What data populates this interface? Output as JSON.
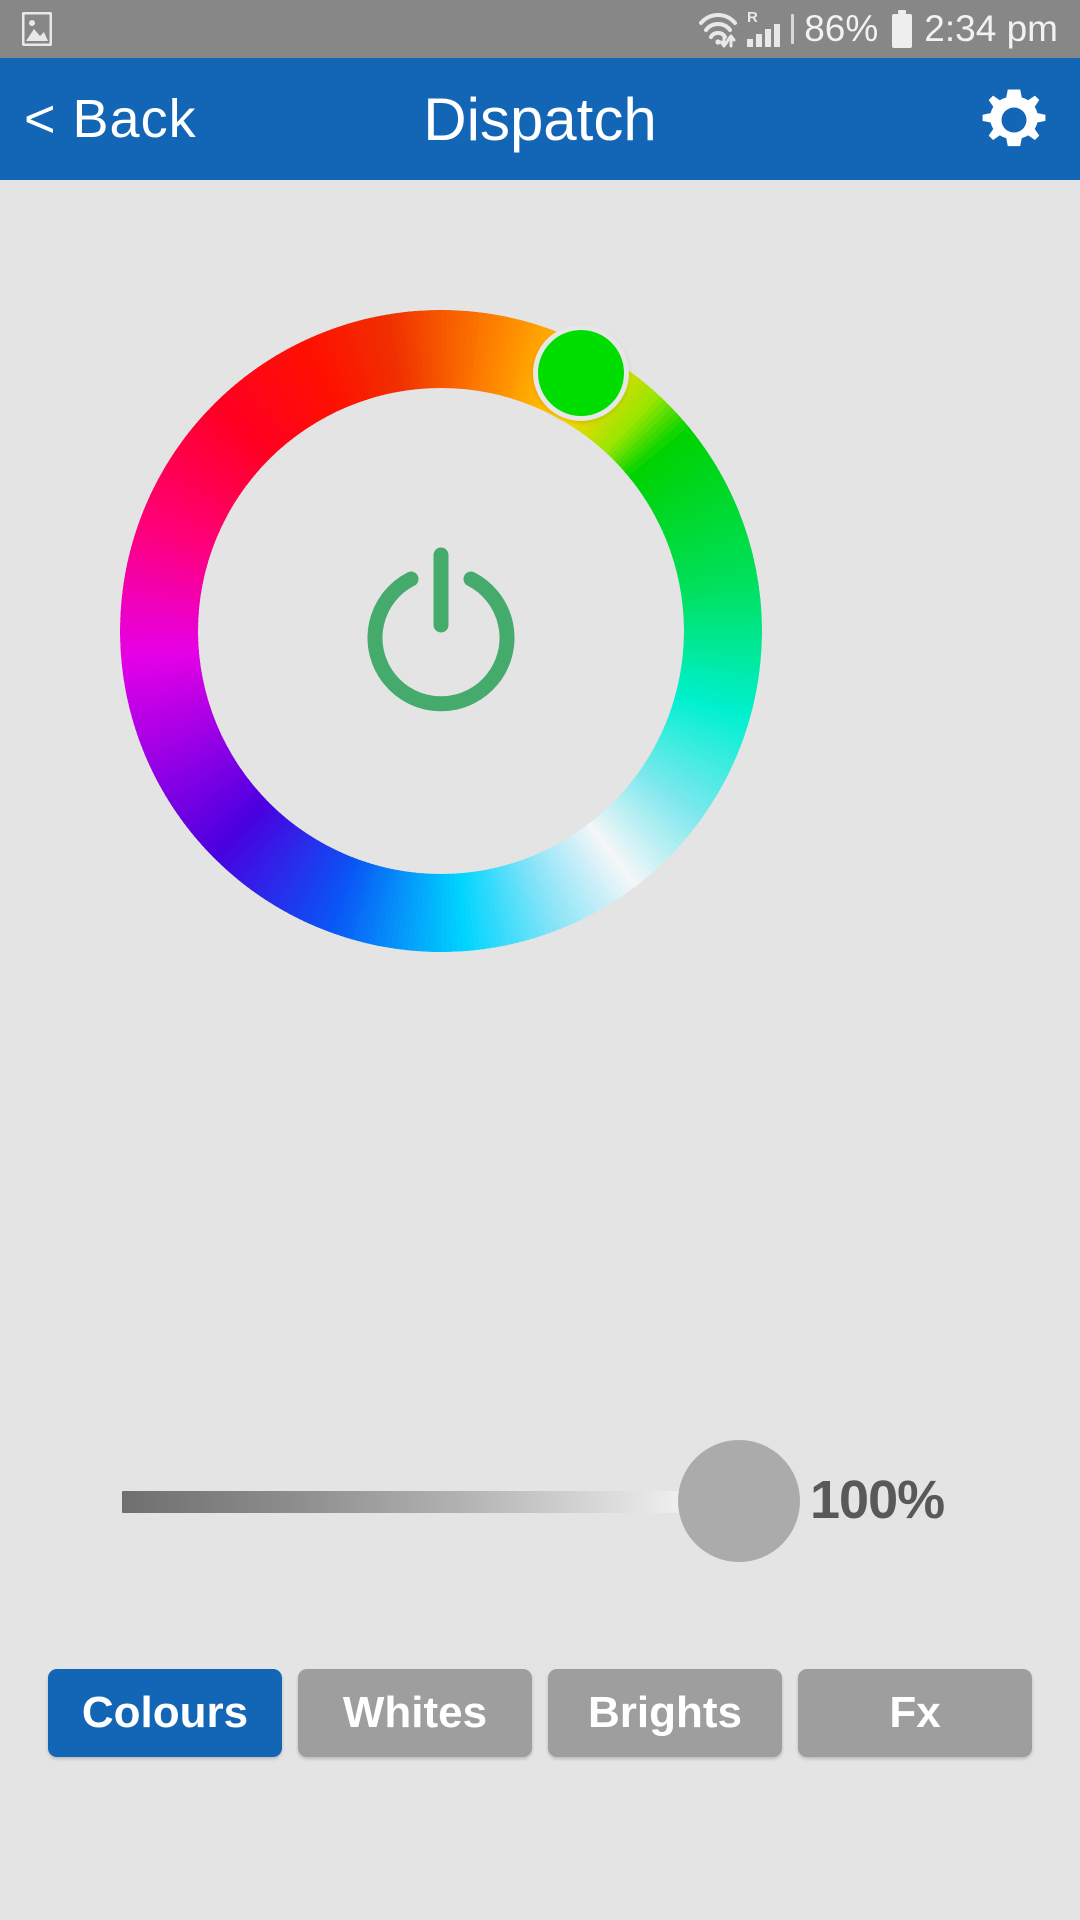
{
  "status_bar": {
    "icons": {
      "gallery": "gallery-icon",
      "wifi": "wifi-icon",
      "roaming": "R",
      "signal": "signal-bars-icon",
      "battery": "battery-icon"
    },
    "battery_percent": "86%",
    "time": "2:34 pm",
    "background": "#878787"
  },
  "app_bar": {
    "back_label": "< Back",
    "title": "Dispatch",
    "settings_icon": "gear-icon",
    "background": "#1366b5"
  },
  "colour_wheel": {
    "handle_color": "#00dd00",
    "handle_angle_deg": 50,
    "power_icon": "power-icon",
    "power_icon_color": "#44ab6c",
    "hue_stops": [
      {
        "angle": 0,
        "color": "#00d200"
      },
      {
        "angle": 30,
        "color": "#00e05c"
      },
      {
        "angle": 55,
        "color": "#00f0d0"
      },
      {
        "angle": 75,
        "color": "#7ce8ee"
      },
      {
        "angle": 92,
        "color": "#f4f6f8"
      },
      {
        "angle": 108,
        "color": "#8ae4f8"
      },
      {
        "angle": 125,
        "color": "#00d5ff"
      },
      {
        "angle": 150,
        "color": "#0a55f5"
      },
      {
        "angle": 175,
        "color": "#4a00e0"
      },
      {
        "angle": 195,
        "color": "#9a00e6"
      },
      {
        "angle": 215,
        "color": "#e600e6"
      },
      {
        "angle": 240,
        "color": "#ff0077"
      },
      {
        "angle": 265,
        "color": "#ff0022"
      },
      {
        "angle": 285,
        "color": "#ff1100"
      },
      {
        "angle": 300,
        "color": "#f03000"
      },
      {
        "angle": 322,
        "color": "#ff8a00"
      },
      {
        "angle": 340,
        "color": "#ffd400"
      },
      {
        "angle": 352,
        "color": "#9ae600"
      },
      {
        "angle": 360,
        "color": "#00d200"
      }
    ]
  },
  "brightness": {
    "value_label": "100%",
    "value": 100,
    "track_from": "#6f6f6f",
    "track_to": "#ffffff",
    "thumb_color": "#ababab"
  },
  "tabs": [
    {
      "label": "Colours",
      "active": true
    },
    {
      "label": "Whites",
      "active": false
    },
    {
      "label": "Brights",
      "active": false
    },
    {
      "label": "Fx",
      "active": false
    }
  ],
  "colors": {
    "page_background": "#e4e4e4",
    "accent_blue": "#1366b5",
    "inactive_gray": "#9e9e9e"
  }
}
